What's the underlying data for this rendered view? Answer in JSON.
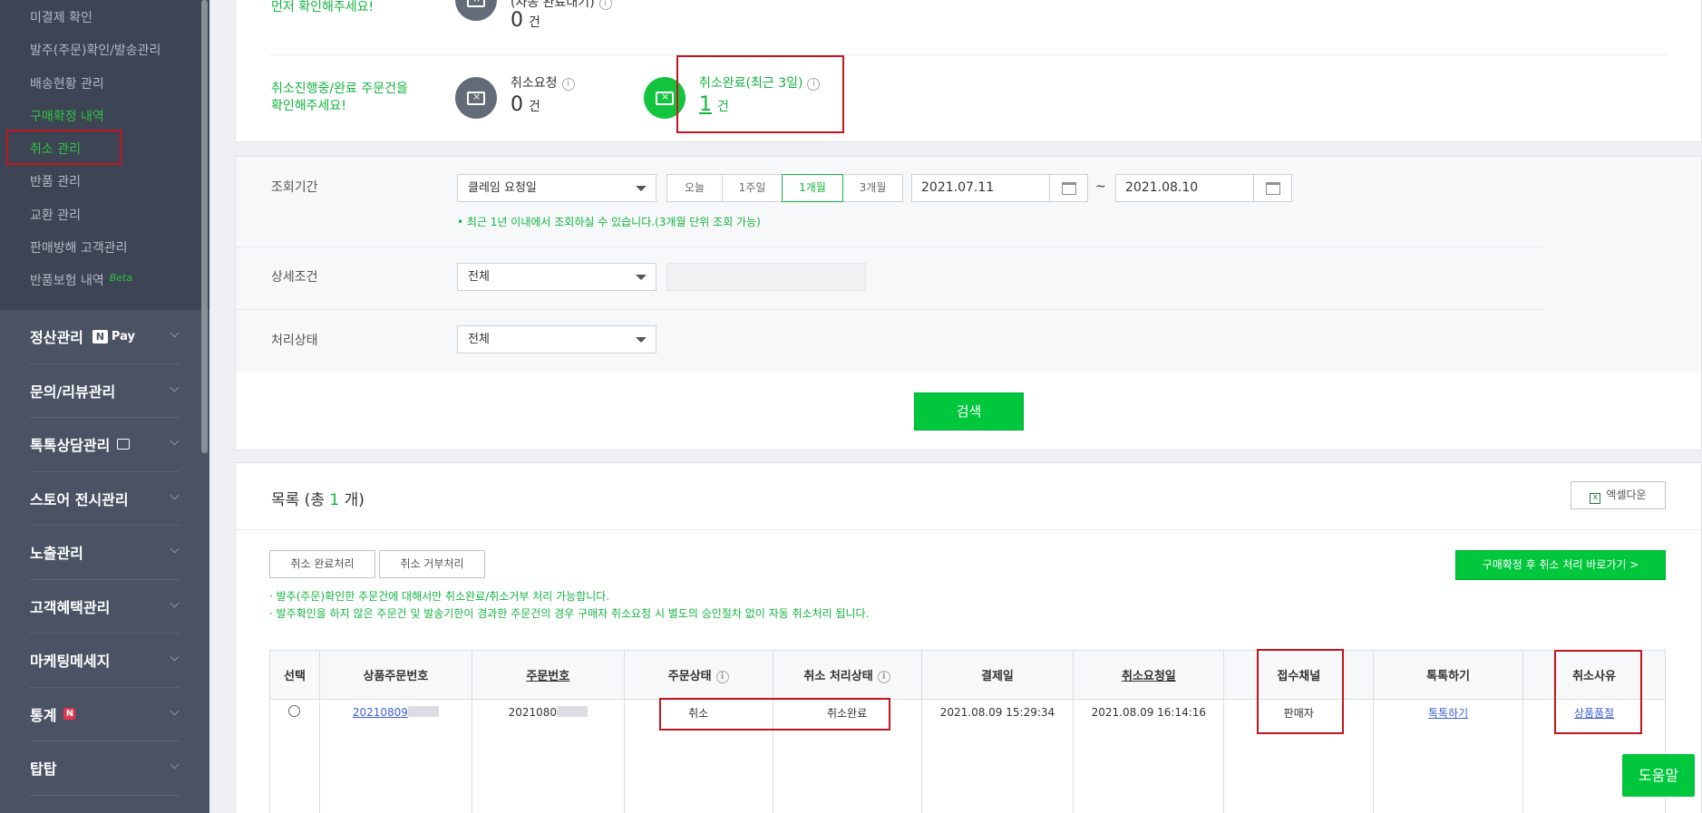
{
  "sidebar": {
    "sub_items": [
      "미결제 확인",
      "발주(주문)확인/발송관리",
      "배송현황 관리",
      "구매확정 내역",
      "취소 관리",
      "반품 관리",
      "교환 관리",
      "판매방해 고객관리",
      "반품보험 내역"
    ],
    "beta_label": "Beta",
    "main_items": [
      "정산관리",
      "문의/리뷰관리",
      "톡톡상담관리",
      "스토어 전시관리",
      "노출관리",
      "고객혜택관리",
      "마케팅메세지",
      "통계",
      "탑탑"
    ],
    "npay_n": "N",
    "npay_label": "Pay",
    "new_badge": "N"
  },
  "summary": {
    "top_guide": "먼저 확인해주세요!",
    "top_label": "(자동 완료대기)",
    "top_value": "0",
    "unit": "건",
    "cancel_guide_line1": "취소진행중/완료 주문건을",
    "cancel_guide_line2": "확인해주세요!",
    "cancel_request_label": "취소요청",
    "cancel_request_value": "0",
    "cancel_done_label": "취소완료(최근 3일)",
    "cancel_done_value": "1"
  },
  "search": {
    "period_label": "조회기간",
    "period_type": "클레임 요청일",
    "period_buttons": [
      "오늘",
      "1주일",
      "1개월",
      "3개월"
    ],
    "active_period": "1개월",
    "date_from": "2021.07.11",
    "tilde": "~",
    "date_to": "2021.08.10",
    "period_help": "• 최근 1년 이내에서 조회하실 수 있습니다.(3개월 단위 조회 가능)",
    "detail_label": "상세조건",
    "detail_value": "전체",
    "status_label": "처리상태",
    "status_value": "전체",
    "search_button": "검색"
  },
  "list": {
    "title_prefix": "목록 (총 ",
    "count": "1",
    "title_suffix": " 개)",
    "excel_button": "엑셀다운",
    "complete_button": "취소 완료처리",
    "reject_button": "취소 거부처리",
    "shortcut_button": "구매확정 후 취소 처리 바로가기 >",
    "note1": "· 발주(주문)확인한 주문건에 대해서만 취소완료/취소거부 처리 가능합니다.",
    "note2": "· 발주확인을 하지 않은 주문건 및 발송기한이 경과한 주문건의 경우 구매자 취소요청 시 별도의 승인절차 없이 자동 취소처리 됩니다.",
    "columns": [
      "선택",
      "상품주문번호",
      "주문번호",
      "주문상태",
      "취소 처리상태",
      "결제일",
      "취소요청일",
      "접수채널",
      "톡톡하기",
      "취소사유"
    ],
    "rows": [
      {
        "product_order_no": "20210809",
        "order_no": "2021080",
        "order_status": "취소",
        "cancel_status": "취소완료",
        "paid_at": "2021.08.09 15:29:34",
        "requested_at": "2021.08.09 16:14:16",
        "channel": "판매자",
        "talk": "톡톡하기",
        "reason": "상품품절"
      }
    ]
  },
  "help_button": "도움말"
}
